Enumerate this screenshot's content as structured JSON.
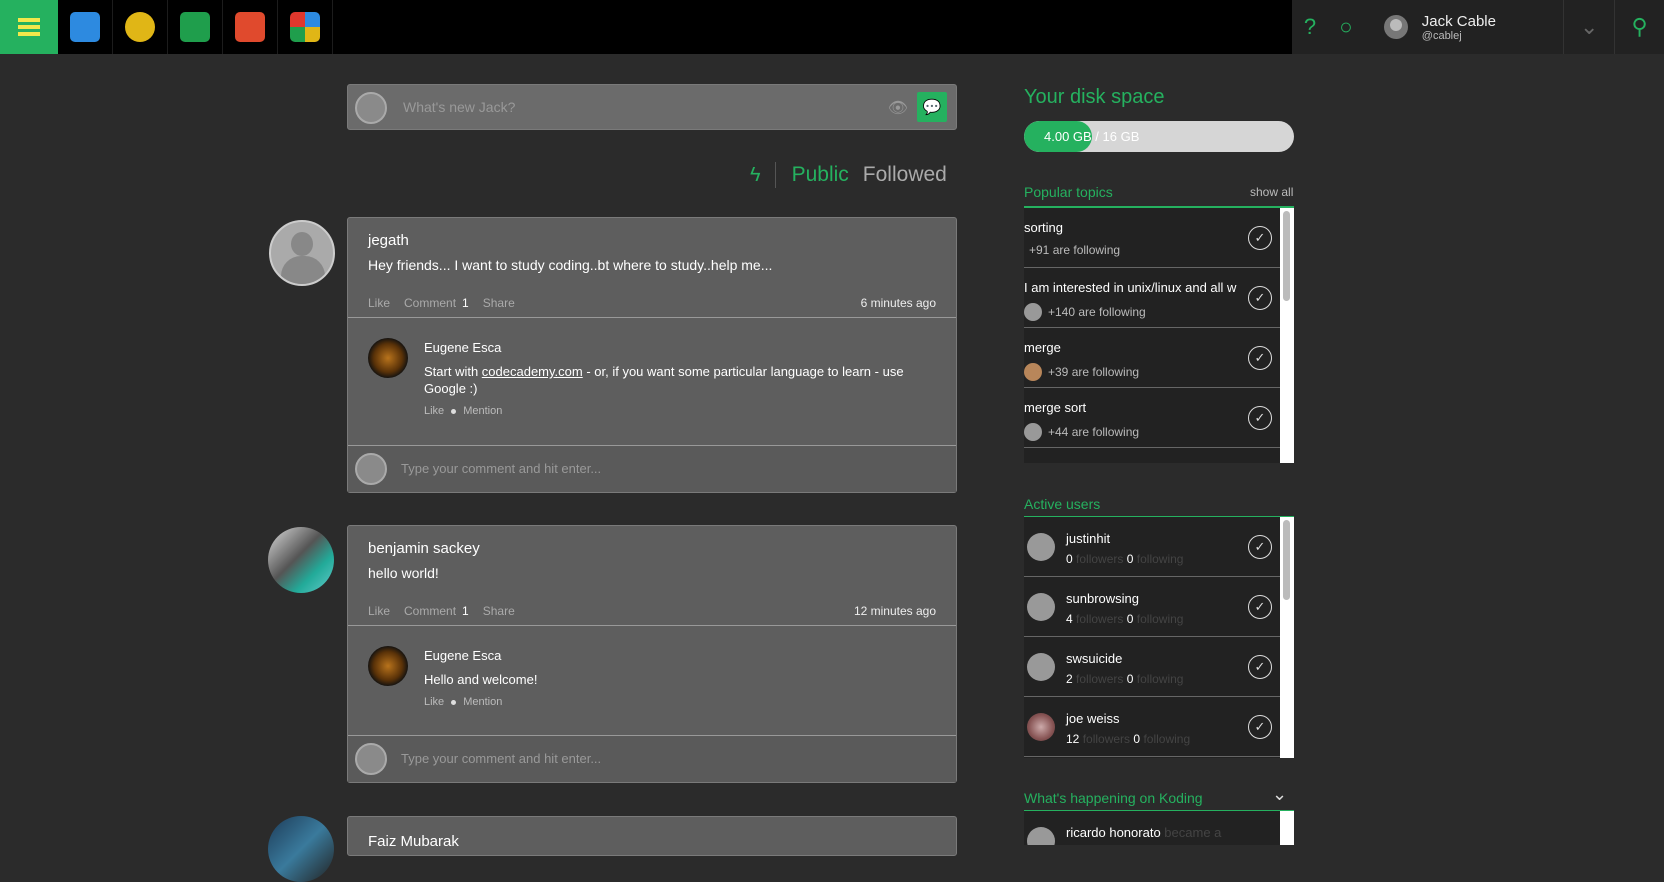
{
  "topbar": {
    "apps": [
      {
        "name": "chat-app-icon",
        "color": "#2d8ae0"
      },
      {
        "name": "koding-app-icon",
        "color": "#e0b616"
      },
      {
        "name": "terminal-app-icon",
        "color": "#1f9e4c"
      },
      {
        "name": "notes-app-icon",
        "color": "#e04a2d"
      },
      {
        "name": "add-app-icon",
        "color": "#e0372d"
      }
    ],
    "user_name": "Jack Cable",
    "user_handle": "@cablej"
  },
  "compose": {
    "placeholder": "What's new Jack?"
  },
  "filters": {
    "public": "Public",
    "followed": "Followed"
  },
  "posts": [
    {
      "author": "jegath",
      "text": "Hey friends... I want to study coding..bt where to study..help me...",
      "like": "Like",
      "comment": "Comment",
      "comment_count": "1",
      "share": "Share",
      "time": "6 minutes ago",
      "comment_item": {
        "author": "Eugene Esca",
        "text_pre": "Start with ",
        "link": "codecademy.com",
        "text_post": " - or, if you want some particular language to learn - use Google :)",
        "like": "Like",
        "mention": "Mention"
      },
      "reply_placeholder": "Type your comment and hit enter..."
    },
    {
      "author": "benjamin sackey",
      "text": "hello world!",
      "like": "Like",
      "comment": "Comment",
      "comment_count": "1",
      "share": "Share",
      "time": "12 minutes ago",
      "comment_item": {
        "author": "Eugene Esca",
        "text": "Hello and welcome!",
        "like": "Like",
        "mention": "Mention"
      },
      "reply_placeholder": "Type your comment and hit enter..."
    },
    {
      "author": "Faiz Mubarak"
    }
  ],
  "sidebar": {
    "disk_title": "Your disk space",
    "disk_label": "4.00 GB / 16 GB",
    "disk_fraction": 0.25,
    "topics_title": "Popular topics",
    "show_all": "show all",
    "topics": [
      {
        "title": "sorting",
        "sub": "+91 are following"
      },
      {
        "title": "I am interested in unix/linux and all w",
        "sub": "+140 are following"
      },
      {
        "title": "merge",
        "sub": "+39 are following"
      },
      {
        "title": "merge sort",
        "sub": "+44 are following"
      }
    ],
    "users_title": "Active users",
    "users": [
      {
        "name": "justinhit",
        "followers": "0",
        "following": "0"
      },
      {
        "name": "sunbrowsing",
        "followers": "4",
        "following": "0"
      },
      {
        "name": "swsuicide",
        "followers": "2",
        "following": "0"
      },
      {
        "name": "joe weiss",
        "followers": "12",
        "following": "0"
      }
    ],
    "followers_word": "followers",
    "following_word": "following",
    "happening_title": "What's happening on Koding",
    "happening_first": "ricardo honorato",
    "happening_first_sub": "became a"
  }
}
